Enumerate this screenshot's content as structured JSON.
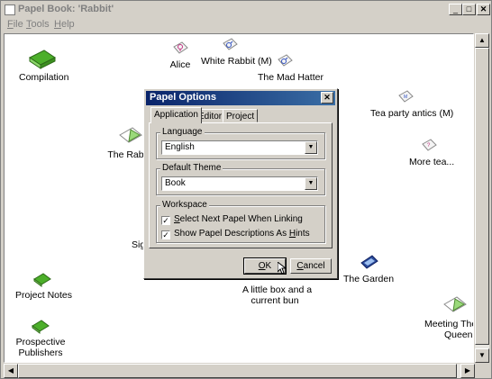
{
  "window": {
    "title": "Papel Book: 'Rabbit'"
  },
  "menu": [
    {
      "label": "File",
      "underline": "F",
      "rest": "ile"
    },
    {
      "label": "Tools",
      "underline": "T",
      "rest": "ools"
    },
    {
      "label": "Help",
      "underline": "H",
      "rest": "elp"
    }
  ],
  "nodes": {
    "compilation": "Compilation",
    "alice": "Alice",
    "white_rabbit": "White Rabbit (M)",
    "mad_hatter": "The Mad Hatter",
    "tea_party": "Tea party antics (M)",
    "more_tea": "More tea...",
    "rabbit": "The Rabbit",
    "sigh": "Sigh",
    "project_notes": "Project Notes",
    "prospective_1": "Prospective",
    "prospective_2": "Publishers",
    "little_box_1": "A little box and a",
    "little_box_2": "current bun",
    "garden": "The Garden",
    "meeting_1": "Meeting The Re",
    "meeting_2": "Queen"
  },
  "dialog": {
    "title": "Papel Options",
    "tabs": [
      "Application",
      "Editor",
      "Project"
    ],
    "language": {
      "label": "Language",
      "value": "English"
    },
    "theme": {
      "label": "Default Theme",
      "value": "Book"
    },
    "workspace": {
      "label": "Workspace",
      "opt1": {
        "label_pre": "",
        "u": "S",
        "label_post": "elect Next Papel When Linking",
        "checked": true
      },
      "opt2": {
        "label_pre": "Show Papel Descriptions As ",
        "u": "H",
        "label_post": "ints",
        "checked": true
      }
    },
    "ok": {
      "u": "O",
      "rest": "K"
    },
    "cancel": {
      "u": "C",
      "rest": "ancel"
    }
  }
}
